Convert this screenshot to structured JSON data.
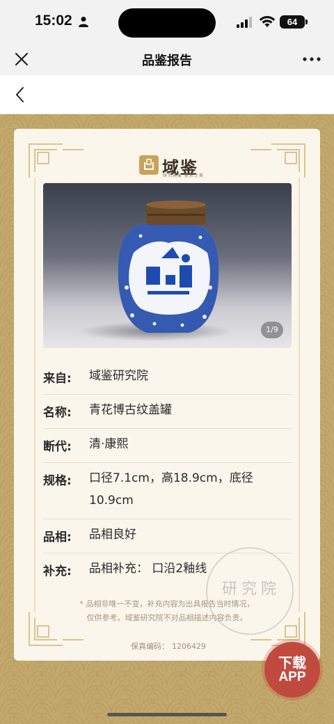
{
  "status_bar": {
    "time": "15:02",
    "battery": "64",
    "icons": [
      "person-icon",
      "signal-icon",
      "wifi-icon",
      "battery-icon"
    ]
  },
  "nav": {
    "title": "品鉴报告",
    "close_icon": "close-icon",
    "more_icon": "more-icon"
  },
  "back_icon": "chevron-left-icon",
  "brand": {
    "name": "域鉴",
    "tagline": "研究典藏 鉴赏之美"
  },
  "photo": {
    "counter": "1/9"
  },
  "details": [
    {
      "label": "来自:",
      "value": "域鉴研究院"
    },
    {
      "label": "名称:",
      "value": "青花博古纹盖罐"
    },
    {
      "label": "断代:",
      "value": "清·康熙"
    },
    {
      "label": "规格:",
      "value": "口径7.1cm，高18.9cm，底径10.9cm"
    },
    {
      "label": "品相:",
      "value": "品相良好"
    },
    {
      "label": "补充:",
      "value": "品相补充：  口沿2釉线"
    }
  ],
  "disclaimer": {
    "line1": "* 品相非唯一不变，补充内容为出具报告当时情况，",
    "line2": "仅供参考。域鉴研究院不对品相描述内容负责。"
  },
  "certificate": {
    "label": "保真编码：",
    "number": "1206429"
  },
  "seal": {
    "text": "研究院"
  },
  "download": {
    "line1": "下载",
    "line2": "APP"
  },
  "colors": {
    "background": "#c2a86c",
    "card": "#fbf6ec",
    "frame": "#d8c494",
    "download": "#c14a3f"
  }
}
